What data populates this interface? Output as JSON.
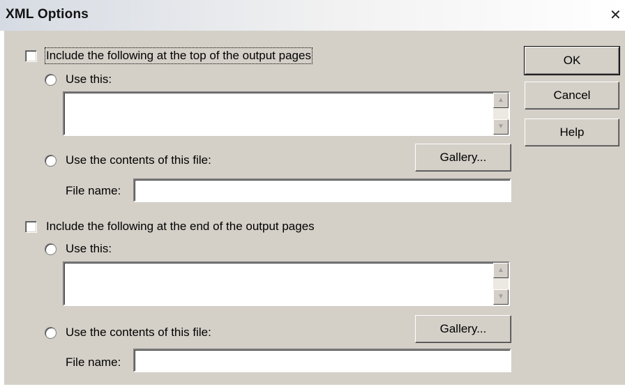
{
  "window": {
    "title": "XML Options",
    "close_glyph": "✕"
  },
  "top_section": {
    "checkbox_label": "Include the following at the top of the output pages",
    "use_this_label": "Use this:",
    "use_file_label": "Use the contents of this file:",
    "gallery_label": "Gallery...",
    "file_name_label": "File name:",
    "file_name_value": ""
  },
  "end_section": {
    "checkbox_label": "Include the following at the end of the output pages",
    "use_this_label": "Use this:",
    "use_file_label": "Use the contents of this file:",
    "gallery_label": "Gallery...",
    "file_name_label": "File name:",
    "file_name_value": ""
  },
  "buttons": {
    "ok": "OK",
    "cancel": "Cancel",
    "help": "Help"
  },
  "icons": {
    "scroll_up": "▲",
    "scroll_down": "▼"
  },
  "colors": {
    "dialog_bg": "#d4d0c8"
  }
}
